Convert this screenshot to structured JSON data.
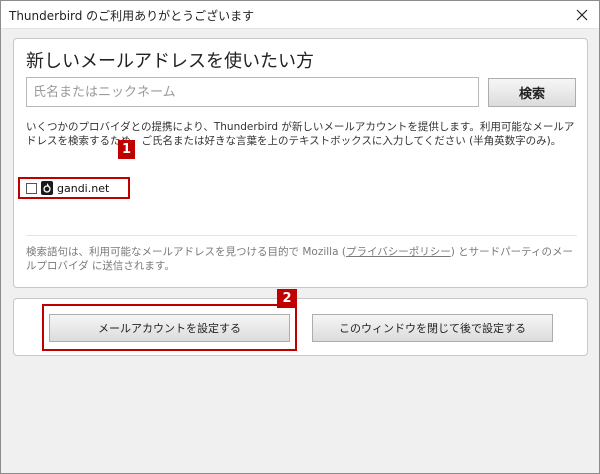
{
  "window": {
    "title": "Thunderbird のご利用ありがとうございます"
  },
  "main": {
    "heading": "新しいメールアドレスを使いたい方",
    "search": {
      "placeholder": "氏名またはニックネーム",
      "value": "",
      "button_label": "検索"
    },
    "description": "いくつかのプロバイダとの提携により、Thunderbird が新しいメールアカウントを提供します。利用可能なメールアドレスを検索するため、ご氏名または好きな言葉を上のテキストボックスに入力してください (半角英数字のみ)。",
    "providers": [
      {
        "name": "gandi.net",
        "checked": false,
        "icon": "gandi-logo-icon"
      }
    ],
    "footnote": {
      "before": "検索語句は、利用可能なメールアドレスを見つける目的で Mozilla (",
      "link": "プライバシーポリシー",
      "after": ") とサードパーティのメールプロバイダ に送信されます。"
    }
  },
  "buttons": {
    "setup": "メールアカウントを設定する",
    "later": "このウィンドウを閉じて後で設定する"
  },
  "annotations": {
    "callout_1": "1",
    "callout_2": "2",
    "color": "#c00000"
  }
}
